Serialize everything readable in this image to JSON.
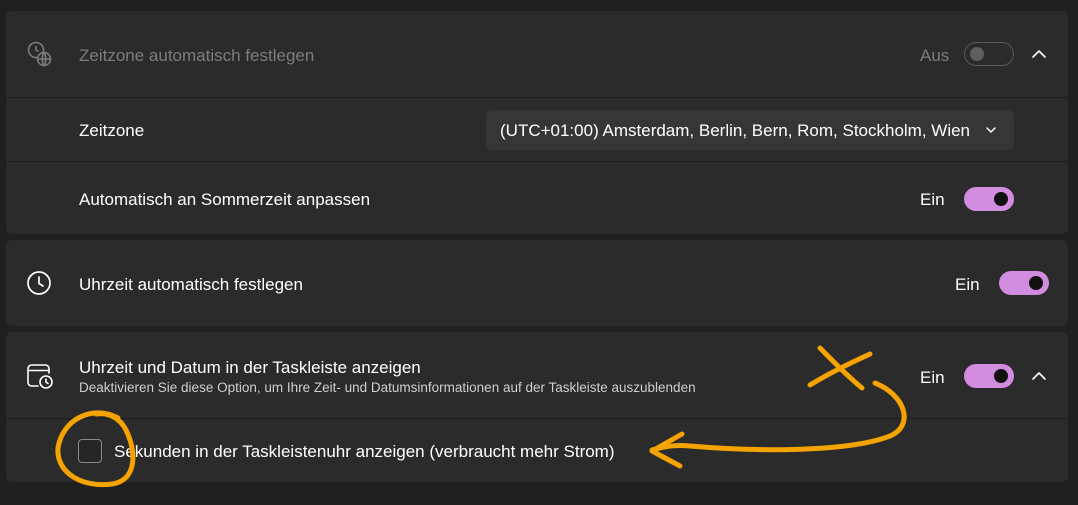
{
  "timezone_card": {
    "auto_timezone": {
      "label": "Zeitzone automatisch festlegen",
      "state_text": "Aus",
      "enabled": false,
      "icon": "globe-clock-icon"
    },
    "timezone": {
      "label": "Zeitzone",
      "selected_value": "(UTC+01:00) Amsterdam, Berlin, Bern, Rom, Stockholm, Wien"
    },
    "dst": {
      "label": "Automatisch an Sommerzeit anpassen",
      "state_text": "Ein",
      "enabled": true
    }
  },
  "auto_time": {
    "label": "Uhrzeit automatisch festlegen",
    "state_text": "Ein",
    "enabled": true,
    "icon": "clock-icon"
  },
  "taskbar_card": {
    "label": "Uhrzeit und Datum in der Taskleiste anzeigen",
    "description": "Deaktivieren Sie diese Option, um Ihre Zeit- und Datumsinformationen auf der Taskleiste auszublenden",
    "state_text": "Ein",
    "enabled": true,
    "icon": "calendar-clock-icon",
    "seconds_option": {
      "label": "Sekunden in der Taskleistenuhr anzeigen (verbraucht mehr Strom)",
      "checked": false
    }
  },
  "colors": {
    "background": "#202020",
    "card": "#2b2b2b",
    "accent": "#d28ce0",
    "annotation": "#f5a300"
  }
}
